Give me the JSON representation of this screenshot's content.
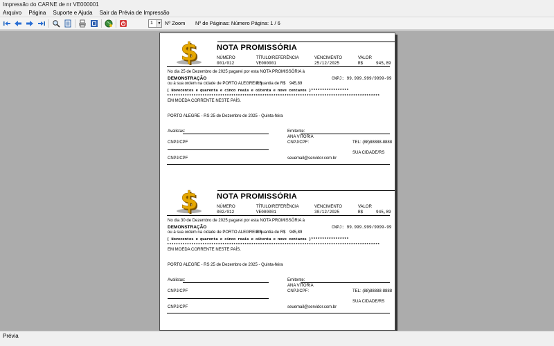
{
  "window": {
    "title": "Impressão do CARNE de nr VE000001"
  },
  "menu": [
    "Arquivo",
    "Página",
    "Suporte e Ajuda",
    "Sair da Prévia de Impressão"
  ],
  "toolbar": {
    "zoom_value": "1",
    "zoom_label": "Nº Zoom",
    "pages_label": "Nº de Páginas: Número Página: 1 / 6",
    "icons": [
      "first-page-icon",
      "prev-page-icon",
      "next-page-icon",
      "last-page-icon",
      "magnify-icon",
      "page-view-icon",
      "print-icon",
      "print-setup-icon",
      "globe-icon",
      "exit-icon"
    ]
  },
  "notes": [
    {
      "title": "NOTA PROMISSÓRIA",
      "headers": {
        "numero": "NÚMERO",
        "titulo": "TÍTULO/REFERÊNCIA",
        "vencimento": "VENCIMENTO",
        "valor": "VALOR"
      },
      "values": {
        "numero": "001/012",
        "titulo": "VE000001",
        "vencimento": "25/12/2025",
        "rs": "R$",
        "valor": "945,89"
      },
      "line1": "No dia 25 de Dezembro de 2025 pagarei por esta NOTA PROMISSÓRIA à",
      "beneficiary": "DEMONSTRAÇÃO",
      "cnpj": "CNPJ:  99.999.999/9999-99",
      "line2": "ou à sua ordem na cidade de PORTO ALEGRE/RS",
      "quantia": "a quantia de R$",
      "quantia_val": "945,89",
      "extenso": "( Novecentos e quarenta e cinco reais e oitenta e nove centavos )*****************",
      "stars": "************************************************************************************************",
      "moeda": "EM MOEDA CORRENTE NESTE PAÍS.",
      "local_data": "PORTO ALEGRE - RS 25 de Dezembro de 2025 - Quinta-feira",
      "avalistas": "Avalistas:",
      "emitente": "Emitente:",
      "emitente_nome": "ANA VITORIA",
      "cnpj_cpf_1": "CNPJ/CPF",
      "emit_cnpj": "CNPJ/CPF:",
      "tel": "TEL: (88)88888-8888",
      "cidade": "SUA CIDADE/RS",
      "cnpj_cpf_2": "CNPJ/CPF",
      "email": "seuemail@servidor.com.br"
    },
    {
      "title": "NOTA PROMISSÓRIA",
      "headers": {
        "numero": "NÚMERO",
        "titulo": "TÍTULO/REFERÊNCIA",
        "vencimento": "VENCIMENTO",
        "valor": "VALOR"
      },
      "values": {
        "numero": "002/012",
        "titulo": "VE000001",
        "vencimento": "30/12/2025",
        "rs": "R$",
        "valor": "945,89"
      },
      "line1": "No dia 30 de Dezembro de 2025 pagarei por esta NOTA PROMISSÓRIA à",
      "beneficiary": "DEMONSTRAÇÃO",
      "cnpj": "CNPJ:  99.999.999/9999-99",
      "line2": "ou à sua ordem na cidade de PORTO ALEGRE/RS",
      "quantia": "a quantia de R$",
      "quantia_val": "945,89",
      "extenso": "( Novecentos e quarenta e cinco reais e oitenta e nove centavos )*****************",
      "stars": "************************************************************************************************",
      "moeda": "EM MOEDA CORRENTE NESTE PAÍS.",
      "local_data": "PORTO ALEGRE - RS 25 de Dezembro de 2025 - Quinta-feira",
      "avalistas": "Avalistas:",
      "emitente": "Emitente:",
      "emitente_nome": "ANA VITORIA",
      "cnpj_cpf_1": "CNPJ/CPF",
      "emit_cnpj": "CNPJ/CPF:",
      "tel": "TEL: (88)88888-8888",
      "cidade": "SUA CIDADE/RS",
      "cnpj_cpf_2": "CNPJ/CPF",
      "email": "seuemail@servidor.com.br"
    }
  ],
  "status": {
    "text": "Prévia"
  },
  "colors": {
    "dollar_gold": "#e6a800",
    "dollar_shadow": "#7a5200",
    "preview_bg": "#acacac"
  }
}
